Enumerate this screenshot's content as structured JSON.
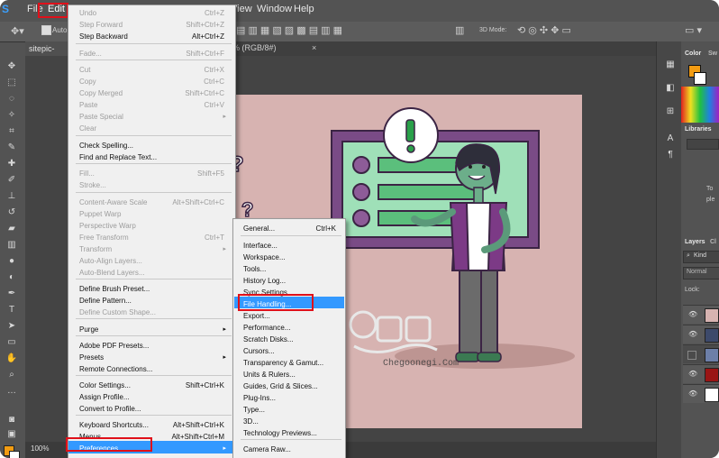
{
  "app": {
    "logo_glyph": "S"
  },
  "menubar": {
    "file": "File",
    "edit": "Edit",
    "view": "View",
    "window": "Window",
    "help": "Help"
  },
  "options_bar": {
    "auto_label": "Auto",
    "mode_3d": "3D Mode:"
  },
  "document": {
    "tab_name": "sitepic-new.",
    "tab_mode": "% (RGB/8#)"
  },
  "status": {
    "zoom": "100%"
  },
  "panels": {
    "color": "Color",
    "swatches": "Sw",
    "libraries": "Libraries",
    "lib_text_1": "To",
    "lib_text_2": "ple",
    "layers": "Layers",
    "layers_tab2": "Cl",
    "kind": "Kind",
    "blend_mode": "Normal",
    "lock": "Lock:"
  },
  "edit_menu": [
    {
      "label": "Undo",
      "shortcut": "Ctrl+Z",
      "enabled": false
    },
    {
      "label": "Step Forward",
      "shortcut": "Shift+Ctrl+Z",
      "enabled": false
    },
    {
      "label": "Step Backward",
      "shortcut": "Alt+Ctrl+Z",
      "enabled": true
    },
    {
      "label": "Fade...",
      "shortcut": "Shift+Ctrl+F",
      "enabled": false
    },
    {
      "label": "Cut",
      "shortcut": "Ctrl+X",
      "enabled": false
    },
    {
      "label": "Copy",
      "shortcut": "Ctrl+C",
      "enabled": false
    },
    {
      "label": "Copy Merged",
      "shortcut": "Shift+Ctrl+C",
      "enabled": false
    },
    {
      "label": "Paste",
      "shortcut": "Ctrl+V",
      "enabled": false
    },
    {
      "label": "Paste Special",
      "shortcut": "",
      "enabled": false,
      "submenu": true
    },
    {
      "label": "Clear",
      "shortcut": "",
      "enabled": false
    },
    {
      "label": "Check Spelling...",
      "shortcut": "",
      "enabled": true
    },
    {
      "label": "Find and Replace Text...",
      "shortcut": "",
      "enabled": true
    },
    {
      "label": "Fill...",
      "shortcut": "Shift+F5",
      "enabled": false
    },
    {
      "label": "Stroke...",
      "shortcut": "",
      "enabled": false
    },
    {
      "label": "Content-Aware Scale",
      "shortcut": "Alt+Shift+Ctrl+C",
      "enabled": false
    },
    {
      "label": "Puppet Warp",
      "shortcut": "",
      "enabled": false
    },
    {
      "label": "Perspective Warp",
      "shortcut": "",
      "enabled": false
    },
    {
      "label": "Free Transform",
      "shortcut": "Ctrl+T",
      "enabled": false
    },
    {
      "label": "Transform",
      "shortcut": "",
      "enabled": false,
      "submenu": true
    },
    {
      "label": "Auto-Align Layers...",
      "shortcut": "",
      "enabled": false
    },
    {
      "label": "Auto-Blend Layers...",
      "shortcut": "",
      "enabled": false
    },
    {
      "label": "Define Brush Preset...",
      "shortcut": "",
      "enabled": true
    },
    {
      "label": "Define Pattern...",
      "shortcut": "",
      "enabled": true
    },
    {
      "label": "Define Custom Shape...",
      "shortcut": "",
      "enabled": false
    },
    {
      "label": "Purge",
      "shortcut": "",
      "enabled": true,
      "submenu": true
    },
    {
      "label": "Adobe PDF Presets...",
      "shortcut": "",
      "enabled": true
    },
    {
      "label": "Presets",
      "shortcut": "",
      "enabled": true,
      "submenu": true
    },
    {
      "label": "Remote Connections...",
      "shortcut": "",
      "enabled": true
    },
    {
      "label": "Color Settings...",
      "shortcut": "Shift+Ctrl+K",
      "enabled": true
    },
    {
      "label": "Assign Profile...",
      "shortcut": "",
      "enabled": true
    },
    {
      "label": "Convert to Profile...",
      "shortcut": "",
      "enabled": true
    },
    {
      "label": "Keyboard Shortcuts...",
      "shortcut": "Alt+Shift+Ctrl+K",
      "enabled": true
    },
    {
      "label": "Menus...",
      "shortcut": "Alt+Shift+Ctrl+M",
      "enabled": true
    },
    {
      "label": "Preferences",
      "shortcut": "",
      "enabled": true,
      "submenu": true,
      "highlighted": true
    }
  ],
  "preferences_submenu": [
    {
      "label": "General...",
      "shortcut": "Ctrl+K"
    },
    {
      "label": "Interface...",
      "shortcut": ""
    },
    {
      "label": "Workspace...",
      "shortcut": ""
    },
    {
      "label": "Tools...",
      "shortcut": ""
    },
    {
      "label": "History Log...",
      "shortcut": ""
    },
    {
      "label": "Sync Settings...",
      "shortcut": ""
    },
    {
      "label": "File Handling...",
      "shortcut": "",
      "highlighted": true
    },
    {
      "label": "Export...",
      "shortcut": ""
    },
    {
      "label": "Performance...",
      "shortcut": ""
    },
    {
      "label": "Scratch Disks...",
      "shortcut": ""
    },
    {
      "label": "Cursors...",
      "shortcut": ""
    },
    {
      "label": "Transparency & Gamut...",
      "shortcut": ""
    },
    {
      "label": "Units & Rulers...",
      "shortcut": ""
    },
    {
      "label": "Guides, Grid & Slices...",
      "shortcut": ""
    },
    {
      "label": "Plug-Ins...",
      "shortcut": ""
    },
    {
      "label": "Type...",
      "shortcut": ""
    },
    {
      "label": "3D...",
      "shortcut": ""
    },
    {
      "label": "Technology Previews...",
      "shortcut": ""
    },
    {
      "label": "Camera Raw...",
      "shortcut": ""
    }
  ],
  "watermark": {
    "site": "Chegoonegi.Com"
  },
  "colors": {
    "accent_highlight": "#3399ff",
    "callout_red": "#e0101a",
    "canvas_bg": "#d7b3b1",
    "foreground_swatch": "#f39c12"
  }
}
